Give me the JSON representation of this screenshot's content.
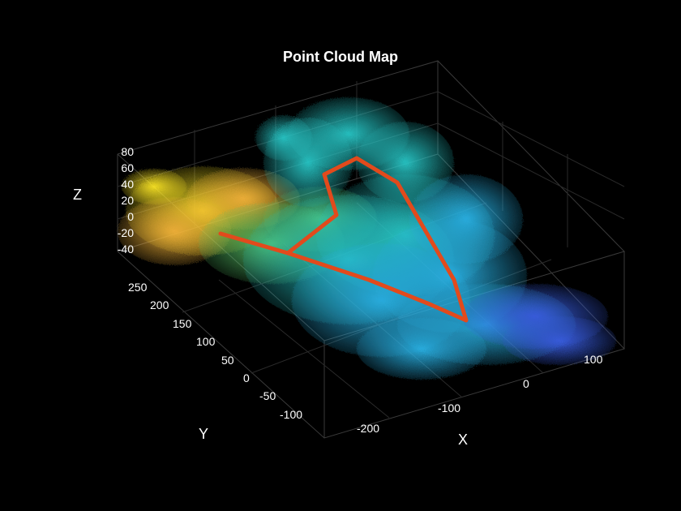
{
  "chart_data": {
    "type": "scatter",
    "title": "Point Cloud Map",
    "xlabel": "X",
    "ylabel": "Y",
    "zlabel": "Z",
    "x_ticks": [
      -200,
      -100,
      0,
      100
    ],
    "y_ticks": [
      -100,
      -50,
      0,
      50,
      100,
      150,
      200,
      250
    ],
    "z_ticks": [
      -40,
      -20,
      0,
      20,
      40,
      60,
      80
    ],
    "xlim": [
      -250,
      150
    ],
    "ylim": [
      -120,
      280
    ],
    "zlim": [
      -40,
      80
    ],
    "colormap": "parula",
    "color_mapped_to": "Y",
    "description": "Dense 3D LiDAR/SfM point cloud of outdoor streets/buildings, colored by Y (yellow at high Y, blue/violet at low Y). A red closed-loop trajectory is overlaid roughly in the Z≈0 plane.",
    "trajectory_color": "#e24a1c",
    "trajectory": [
      {
        "x": -140,
        "y": 190,
        "z": 0
      },
      {
        "x": -60,
        "y": 135,
        "z": 0
      },
      {
        "x": 70,
        "y": 40,
        "z": 0
      },
      {
        "x": 95,
        "y": -70,
        "z": 0
      },
      {
        "x": 10,
        "y": -95,
        "z": 0
      },
      {
        "x": -40,
        "y": -30,
        "z": 0
      },
      {
        "x": -60,
        "y": 60,
        "z": 0
      },
      {
        "x": -120,
        "y": 155,
        "z": 0
      },
      {
        "x": -140,
        "y": 190,
        "z": 0
      }
    ],
    "cloud_extent_note": "point cloud spans approximately X∈[-240,140], Y∈[-110,270], Z∈[-30,70]"
  }
}
